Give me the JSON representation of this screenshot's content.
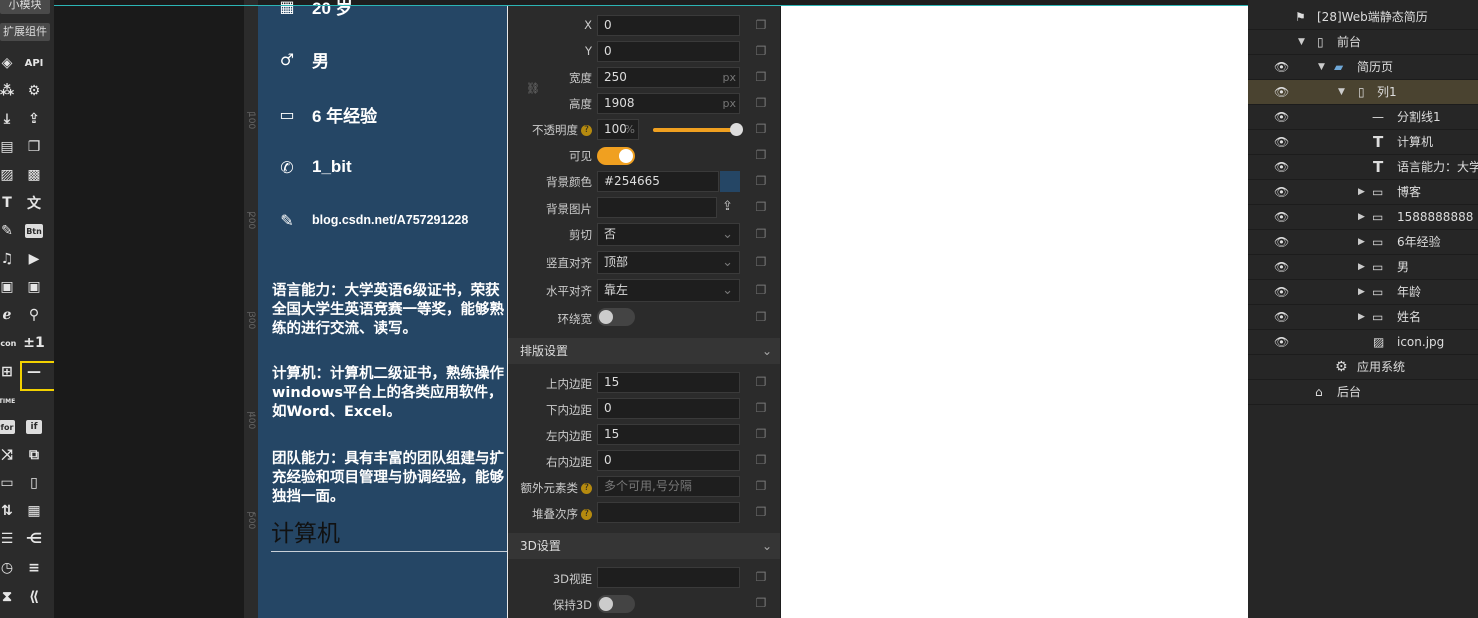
{
  "toolbar": {
    "tab_small_module": "小模块",
    "tab_extension": "扩展组件",
    "api_label": "API",
    "btn_label": "Btn",
    "plusminus_label": "±1",
    "icon_label": "icon",
    "for_label": "for",
    "if_label": "if",
    "time_label": "TIME"
  },
  "ruler": {
    "labels": [
      "100",
      "200",
      "300",
      "400",
      "500"
    ]
  },
  "resume": {
    "bg_color": "#254665",
    "age": "20 岁",
    "gender": "男",
    "experience": "6 年经验",
    "contact": "1_bit",
    "blog": "blog.csdn.net/A757291228",
    "paragraph_language": "语言能力：大学英语6级证书，荣获全国大学生英语竞赛一等奖，能够熟练的进行交流、读写。",
    "paragraph_computer": "计算机：计算机二级证书，熟练操作windows平台上的各类应用软件，如Word、Excel。",
    "paragraph_team": "团队能力：具有丰富的团队组建与扩充经验和项目管理与协调经验，能够独挡一面。",
    "heading_computer": "计算机"
  },
  "props": {
    "x_label": "X",
    "x_value": "0",
    "y_label": "Y",
    "y_value": "0",
    "width_label": "宽度",
    "width_value": "250",
    "width_unit": "px",
    "height_label": "高度",
    "height_value": "1908",
    "height_unit": "px",
    "opacity_label": "不透明度",
    "opacity_value": "100",
    "opacity_unit": "%",
    "opacity_level": 1.0,
    "visible_label": "可见",
    "visible_on": true,
    "bgcolor_label": "背景颜色",
    "bgcolor_value": "#254665",
    "bgimage_label": "背景图片",
    "clip_label": "剪切",
    "clip_value": "否",
    "valign_label": "竖直对齐",
    "valign_value": "顶部",
    "halign_label": "水平对齐",
    "halign_value": "靠左",
    "wrap_label": "环绕宽",
    "wrap_on": false,
    "layout_section": "排版设置",
    "pad_top_label": "上内边距",
    "pad_top_value": "15",
    "pad_bottom_label": "下内边距",
    "pad_bottom_value": "0",
    "pad_left_label": "左内边距",
    "pad_left_value": "15",
    "pad_right_label": "右内边距",
    "pad_right_value": "0",
    "extra_label": "额外元素类",
    "extra_placeholder": "多个可用,号分隔",
    "zindex_label": "堆叠次序",
    "section_3d": "3D设置",
    "view3d_label": "3D视距",
    "keep3d_label": "保持3D",
    "keep3d_on": false,
    "accent_color": "#f0a020"
  },
  "layers": {
    "project": "[28]Web端静态简历",
    "frontend": "前台",
    "page": "简历页",
    "column": "列1",
    "divider": "分割线1",
    "text_computer": "计算机",
    "text_language": "语言能力：大学",
    "row_blog": "博客",
    "row_phone": "1588888888",
    "row_exp": "6年经验",
    "row_gender": "男",
    "row_age": "年龄",
    "row_name": "姓名",
    "image_icon": "icon.jpg",
    "app_system": "应用系统",
    "backend": "后台"
  }
}
